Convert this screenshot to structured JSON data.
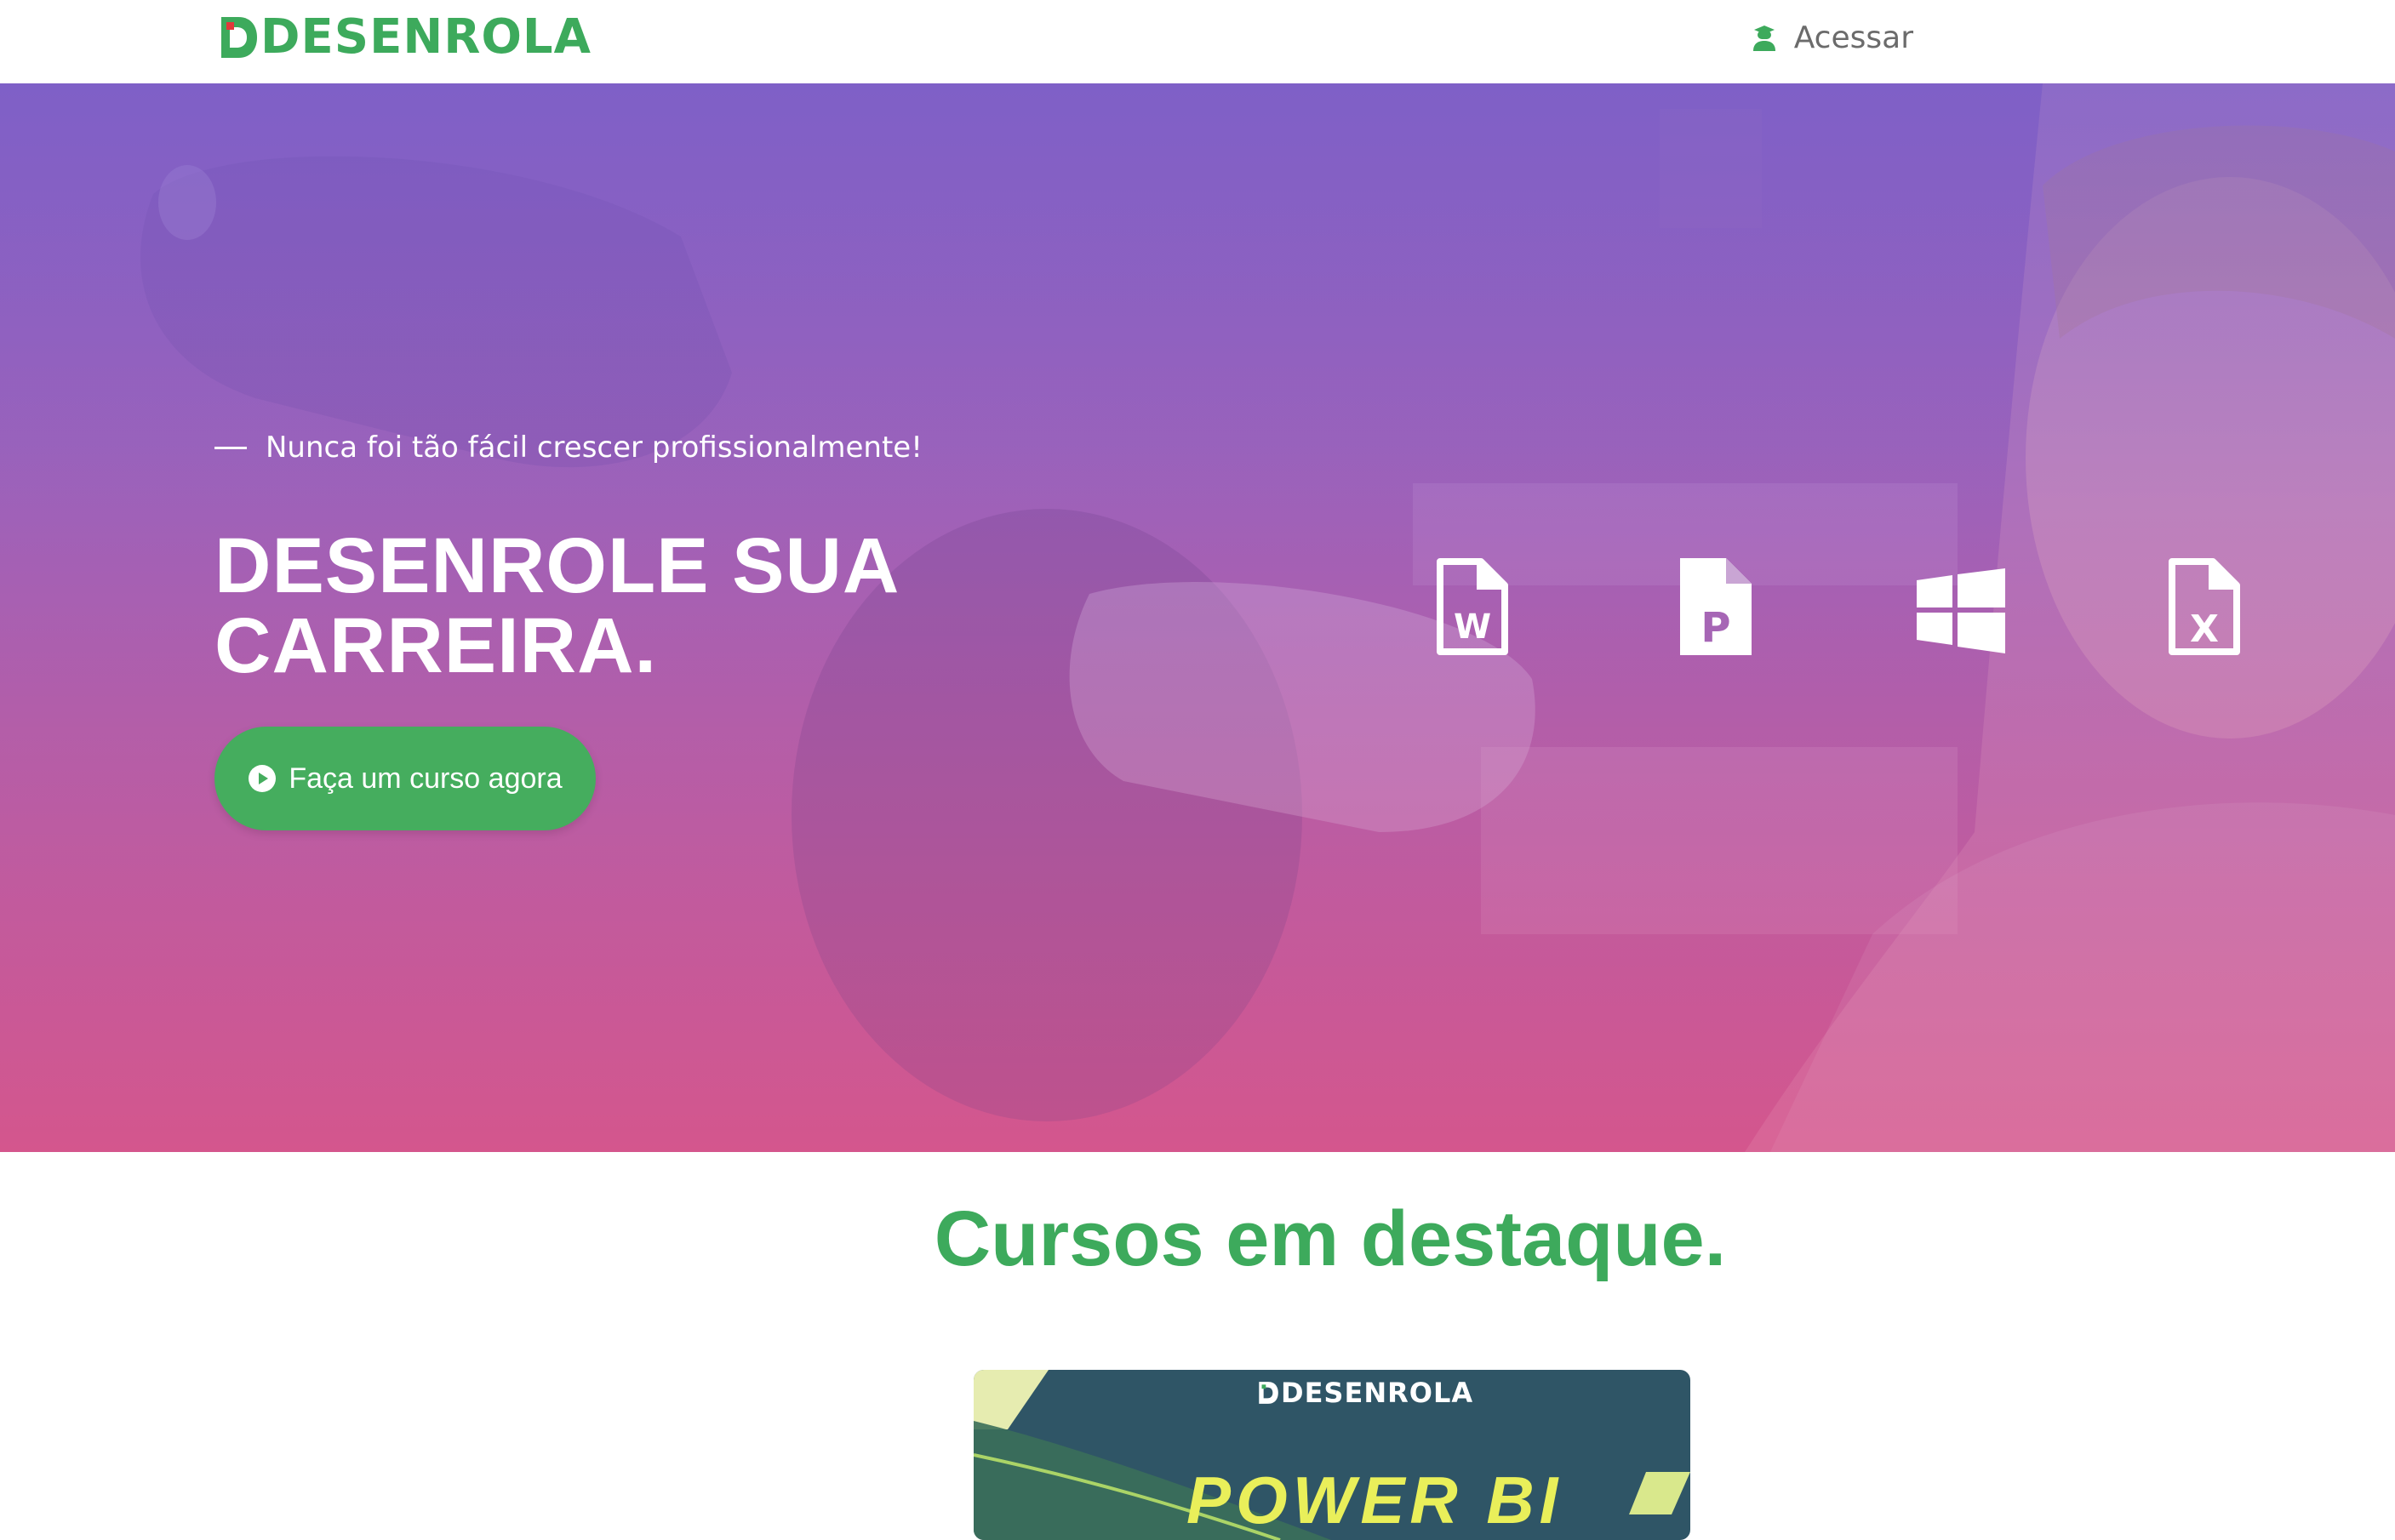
{
  "header": {
    "logo_text": "DESENROLA",
    "access_label": "Acessar"
  },
  "hero": {
    "tagline": "Nunca foi tão fácil crescer profissionalmente!",
    "title_line1": "DESENROLE SUA",
    "title_line2": "CARREIRA.",
    "cta_label": "Faça um curso agora",
    "app_icons": [
      "word-file-icon",
      "powerpoint-file-icon",
      "windows-icon",
      "excel-file-icon"
    ]
  },
  "featured": {
    "title": "Cursos em destaque.",
    "card": {
      "logo_text": "DESENROLA",
      "course_title": "POWER BI"
    }
  },
  "colors": {
    "brand_green": "#3daa5c",
    "cta_green": "#45ad5e",
    "hero_purple": "#8462c6",
    "hero_pink": "#d2568e",
    "card_teal": "#2f5566",
    "card_yellow": "#e9ef5a"
  }
}
